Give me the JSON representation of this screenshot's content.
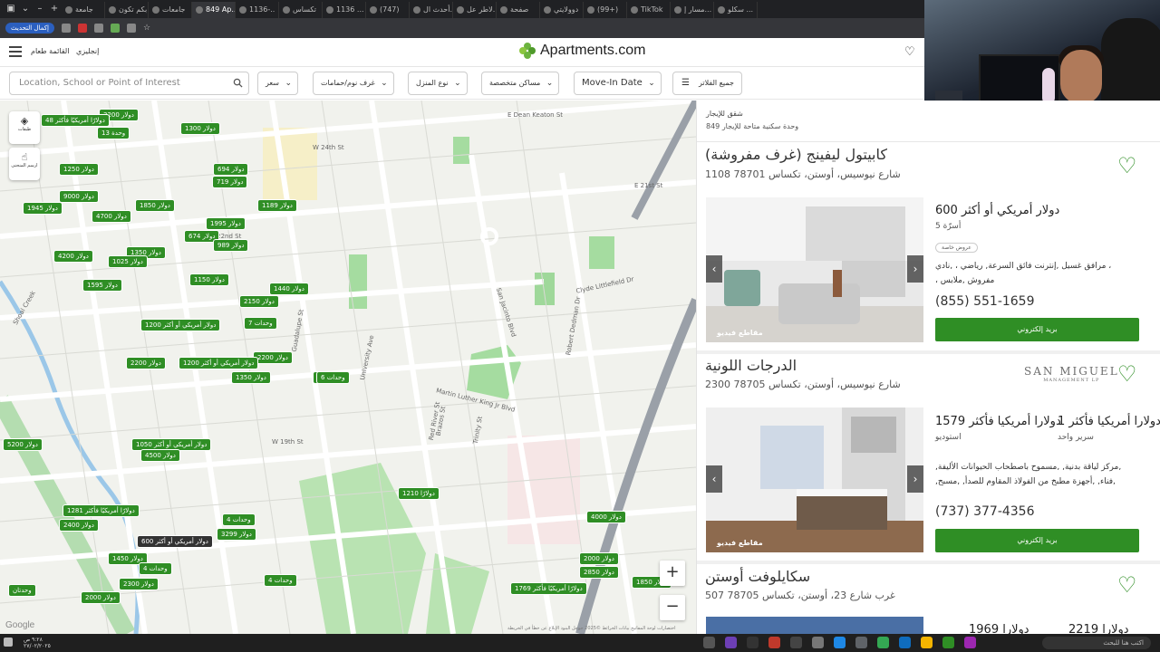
{
  "browser": {
    "tabs": [
      "سكلو ...",
      "مسار إ...",
      "TikTok",
      "(99+)",
      "دوولايتي",
      "صفحة",
      "لاطر عل...",
      "أحدث ال...",
      "(747)",
      "1136 ...",
      "تكساس",
      "1136-..",
      "849 Ap...",
      "جامعات",
      "بكم تكون",
      "جامعة"
    ],
    "update_label": "إكمال التحديث"
  },
  "site": {
    "menu_label": "القائمة طعام",
    "lang_label": "إنجليزي",
    "logo_text": "Apartments.com",
    "brand_color": "#6cb33f"
  },
  "filters": {
    "search_placeholder": "Location, School or Point of Interest",
    "price": "سعر",
    "beds": "غرف نوم/حمامات",
    "home_type": "نوع المنزل",
    "specialty": "مساكن متخصصة",
    "move_in": "Move-In Date",
    "all_filters": "جميع الفلاتر"
  },
  "map": {
    "layers_label": "طبقات",
    "draw_label": "ارسم المنحنى",
    "google": "Google",
    "attribution": "اختصارات لوحة المفاتيح  بيانات الخرائط ©2025 جوجل  البنود  الإبلاغ عن خطأ في الخريطة",
    "streets": [
      "E Dean Keaton St",
      "W 24th St",
      "Guadalupe St",
      "Clyde Littlefield Dr",
      "Robert Dedman Dr",
      "San Jacinto Blvd",
      "Martin Luther King Jr Blvd",
      "University Ave",
      "Brazos St",
      "Red River St",
      "Trinity St",
      "Shoal Creek",
      "E 21st St",
      "W 22nd St",
      "W 19th St"
    ],
    "pins": [
      {
        "label": "3200 دولار"
      },
      {
        "label": "48 دولارًا أمريكيًا فأكثر"
      },
      {
        "label": "13 وحدة"
      },
      {
        "label": "1300 دولار"
      },
      {
        "label": "1250 دولار"
      },
      {
        "label": "694 دولار"
      },
      {
        "label": "719 دولار"
      },
      {
        "label": "9000 دولار"
      },
      {
        "label": "1945 دولار"
      },
      {
        "label": "1850 دولار"
      },
      {
        "label": "1189 دولار"
      },
      {
        "label": "4700 دولار"
      },
      {
        "label": "1995 دولار"
      },
      {
        "label": "674 دولار"
      },
      {
        "label": "989 دولار"
      },
      {
        "label": "4200 دولار"
      },
      {
        "label": "1350 دولار"
      },
      {
        "label": "1025 دولار"
      },
      {
        "label": "1595 دولار"
      },
      {
        "label": "1150 دولار"
      },
      {
        "label": "1440 دولار"
      },
      {
        "label": "2150 دولار"
      },
      {
        "label": "1200 دولار أمريكي أو أكثر"
      },
      {
        "label": "7 وحدات"
      },
      {
        "label": "2200 دولار"
      },
      {
        "label": "2200 دولار"
      },
      {
        "label": "1200 دولار أمريكي أو أكثر"
      },
      {
        "label": "1350 دولار"
      },
      {
        "label": "6 وحدات"
      },
      {
        "label": "5200 دولار"
      },
      {
        "label": "1050 دولار أمريكي أو أكثر"
      },
      {
        "label": "4500 دولار"
      },
      {
        "label": "1210 دولارًا"
      },
      {
        "label": "1281 دولارًا أمريكيًا فأكثر"
      },
      {
        "label": "2400 دولار"
      },
      {
        "label": "4 وحدات"
      },
      {
        "label": "3299 دولار"
      },
      {
        "label": "600 دولار أمريكي أو أكثر"
      },
      {
        "label": "1450 دولار"
      },
      {
        "label": "4 وحدات"
      },
      {
        "label": "2300 دولار"
      },
      {
        "label": "4000 دولار"
      },
      {
        "label": "2000 دولار"
      },
      {
        "label": "2850 دولار"
      },
      {
        "label": "1850 دولار"
      },
      {
        "label": "1769 دولارًا أمريكيًا فأكثر"
      },
      {
        "label": "2000 دولار"
      },
      {
        "label": "4 وحدات"
      },
      {
        "label": "وحدتان"
      },
      {
        "label": "6 وحدات"
      }
    ]
  },
  "results": {
    "title": "شقق للإيجار",
    "count": "849 وحدة سكنية متاحة للإيجار"
  },
  "listings": [
    {
      "title": "كابيتول ليفينج (غرف مفروشة)",
      "address": "1108 شارع نيوسيس، أوستن، تكساس 78701",
      "price": "600 دولار أمريكي أو أكثر",
      "beds": "5 أسرّة",
      "tag": "عروض خاصة",
      "amenities": [
        "مرافق غسيل ,إنترنت فائق السرعة, رياضي ، ,نادي ،",
        "، مفروش ,ملابس"
      ],
      "phone": "(855) 551-1659",
      "email": "بريد إلكتروني",
      "video": "مقاطع فيديو"
    },
    {
      "title": "الدرجات اللونية",
      "address": "2300 شارع نيوسيس، أوستن، تكساس 78705",
      "logo": "SAN MIGUEL",
      "logo_sub": "MANAGEMENT LP",
      "prices": [
        {
          "price": "1579 دولارا أمريكيا فأكثر",
          "beds": "استوديو"
        },
        {
          "price": "1 دولارا أمريكيا فأكثر",
          "beds": "سرير واحد"
        }
      ],
      "amenities": [
        ",مركز لياقة بدنية, ,مسموح باصطحاب الحيوانات الأليفة,",
        ",فناء, ,أجهزة مطبخ من الفولاذ المقاوم للصدأ, ,مسبح,"
      ],
      "phone": "(737) 377-4356",
      "email": "بريد إلكتروني",
      "video": "مقاطع فيديو"
    },
    {
      "title": "سكايلوفت أوستن",
      "address": "507 غرب شارع 23، أوستن، تكساس 78705",
      "prices": [
        "1969 دولارا",
        "2219 دولارا"
      ]
    }
  ],
  "taskbar": {
    "time": "٩:٢٨ ص",
    "date": "٢٧/٠٢/٢٠٢٥",
    "search": "اكتب هنا للبحث"
  }
}
